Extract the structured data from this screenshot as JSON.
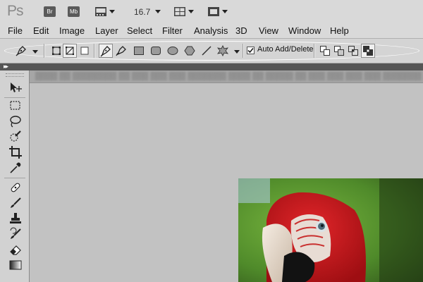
{
  "app": {
    "logo": "Ps",
    "bridge_label": "Br",
    "minibridge_label": "Mb",
    "zoom_level": "16.7"
  },
  "menu": {
    "items": [
      "File",
      "Edit",
      "Image",
      "Layer",
      "Select",
      "Filter",
      "Analysis",
      "3D",
      "View",
      "Window",
      "Help"
    ]
  },
  "options_bar": {
    "auto_add_delete_label": "Auto Add/Delete",
    "auto_add_delete_checked": true
  },
  "colors": {
    "parrot_red": "#c8141a",
    "background_green": "#4f8a2a",
    "canvas_gray": "#c2c2c2"
  },
  "icons": {
    "toolbox": [
      "move-icon",
      "marquee-icon",
      "lasso-icon",
      "quick-selection-icon",
      "crop-icon",
      "eyedropper-icon",
      "healing-brush-icon",
      "brush-icon",
      "clone-stamp-icon",
      "history-brush-icon",
      "eraser-icon",
      "gradient-icon"
    ]
  }
}
